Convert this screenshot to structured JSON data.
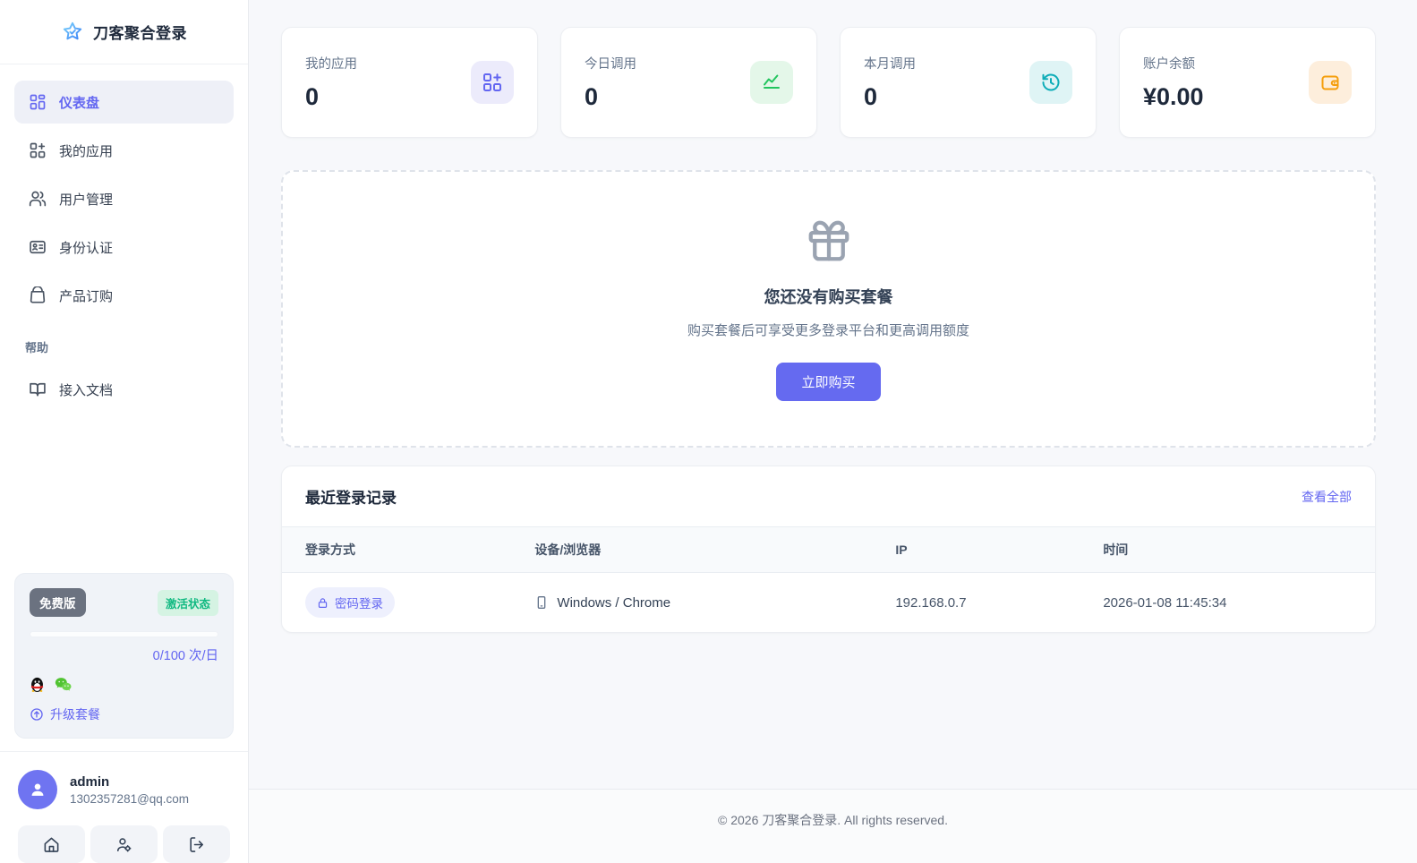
{
  "app": {
    "title": "刀客聚合登录"
  },
  "sidebar": {
    "menu": [
      {
        "label": "仪表盘",
        "active": true
      },
      {
        "label": "我的应用",
        "active": false
      },
      {
        "label": "用户管理",
        "active": false
      },
      {
        "label": "身份认证",
        "active": false
      },
      {
        "label": "产品订购",
        "active": false
      }
    ],
    "help_section_label": "帮助",
    "docs_label": "接入文档",
    "plan": {
      "name_badge": "免费版",
      "status_badge": "激活状态",
      "quota_text": "0/100 次/日",
      "platform_icons": [
        "qq-icon",
        "wechat-icon"
      ],
      "upgrade_label": "升级套餐"
    },
    "user": {
      "name": "admin",
      "email": "1302357281@qq.com"
    }
  },
  "stats": [
    {
      "label": "我的应用",
      "value": "0",
      "icon": "grid-plus-icon",
      "color": "#6366f1"
    },
    {
      "label": "今日调用",
      "value": "0",
      "icon": "trend-chart-icon",
      "color": "#22c55e"
    },
    {
      "label": "本月调用",
      "value": "0",
      "icon": "history-clock-icon",
      "color": "#0eadb8"
    },
    {
      "label": "账户余额",
      "value": "¥0.00",
      "icon": "wallet-icon",
      "color": "#f59e0b"
    }
  ],
  "empty_state": {
    "icon": "gift-icon",
    "title": "您还没有购买套餐",
    "subtitle": "购买套餐后可享受更多登录平台和更高调用额度",
    "button_label": "立即购买"
  },
  "recent_logins": {
    "title": "最近登录记录",
    "view_all_label": "查看全部",
    "columns": [
      "登录方式",
      "设备/浏览器",
      "IP",
      "时间"
    ],
    "rows": [
      {
        "method": "密码登录",
        "device": "Windows / Chrome",
        "ip": "192.168.0.7",
        "time": "2026-01-08 11:45:34"
      }
    ]
  },
  "footer": {
    "copyright": "© 2026 刀客聚合登录. All rights reserved."
  },
  "colors": {
    "primary": "#6366f1",
    "success": "#10b981",
    "teal": "#0eadb8",
    "orange": "#f59e0b",
    "sidebar_bg": "#ffffff",
    "main_bg": "#f7f8fb"
  }
}
